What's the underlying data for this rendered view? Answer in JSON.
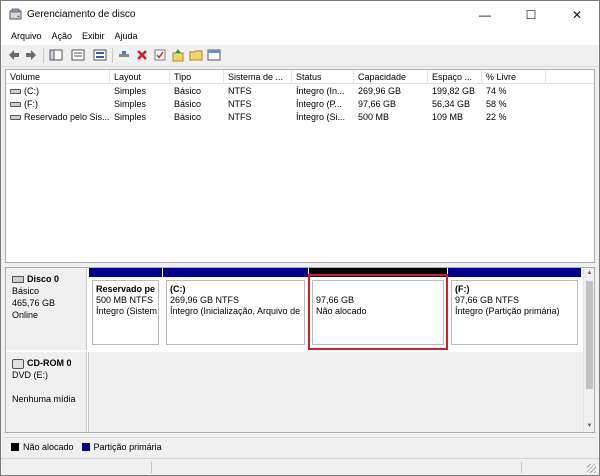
{
  "window": {
    "title": "Gerenciamento de disco",
    "controls": {
      "minimize": "—",
      "maximize": "☐",
      "close": "✕"
    }
  },
  "menu": [
    "Arquivo",
    "Ação",
    "Exibir",
    "Ajuda"
  ],
  "toolbar": {
    "icons": [
      "back-arrow-icon",
      "forward-arrow-icon",
      "console-tree-icon",
      "properties-icon",
      "help-icon",
      "disk-view-icon",
      "connect-icon",
      "delete-icon",
      "check-icon",
      "upload-icon",
      "folder-icon",
      "window-icon"
    ]
  },
  "volume_list": {
    "columns": [
      "Volume",
      "Layout",
      "Tipo",
      "Sistema de ...",
      "Status",
      "Capacidade",
      "Espaço ...",
      "% Livre"
    ],
    "rows": [
      [
        "(C:)",
        "Simples",
        "Básico",
        "NTFS",
        "Íntegro (In...",
        "269,96 GB",
        "199,82 GB",
        "74 %"
      ],
      [
        "(F:)",
        "Simples",
        "Básico",
        "NTFS",
        "Íntegro (P...",
        "97,66 GB",
        "56,34 GB",
        "58 %"
      ],
      [
        "Reservado pelo Sis...",
        "Simples",
        "Básico",
        "NTFS",
        "Íntegro (Si...",
        "500 MB",
        "109 MB",
        "22 %"
      ]
    ]
  },
  "disks": {
    "disk0": {
      "name": "Disco 0",
      "type": "Básico",
      "size": "465,76 GB",
      "state": "Online",
      "partitions": [
        {
          "title": "Reservado pe",
          "size": "500 MB NTFS",
          "status": "Íntegro (Sistem"
        },
        {
          "title": "(C:)",
          "size": "269,96 GB NTFS",
          "status": "Íntegro (Inicialização, Arquivo de"
        },
        {
          "title": "",
          "size": "97,66 GB",
          "status": "Não alocado"
        },
        {
          "title": "(F:)",
          "size": "97,66 GB NTFS",
          "status": "Íntegro (Partição primária)"
        }
      ]
    },
    "cdrom0": {
      "name": "CD-ROM 0",
      "drive": "DVD (E:)",
      "media": "Nenhuma mídia"
    }
  },
  "legend": {
    "unallocated": "Não alocado",
    "primary": "Partição primária",
    "colors": {
      "unallocated": "#000000",
      "primary": "#00008b",
      "selection": "#d0202a"
    }
  }
}
